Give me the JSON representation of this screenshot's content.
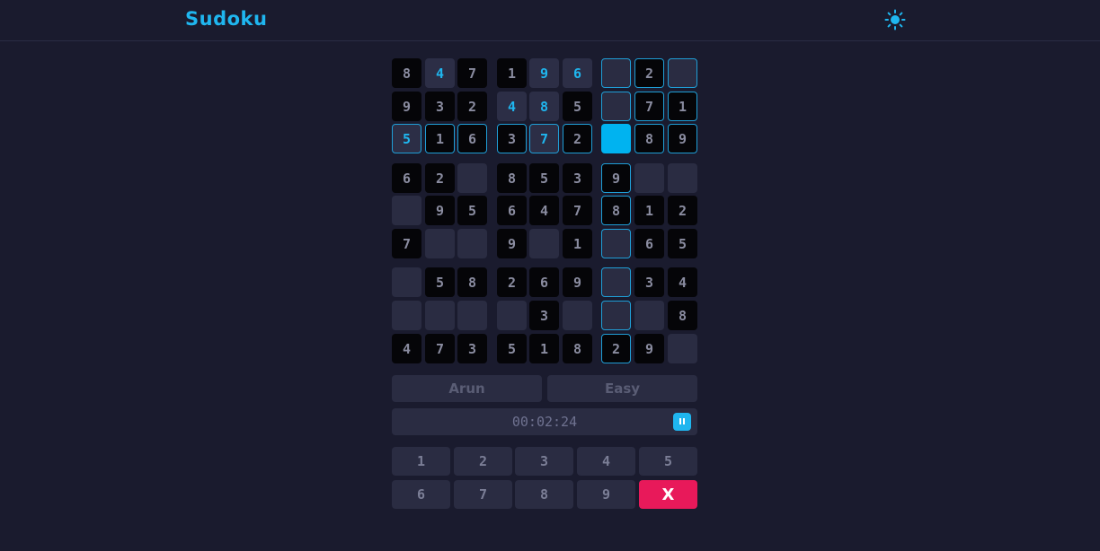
{
  "header": {
    "title": "Sudoku",
    "theme_icon": "sun-icon",
    "accent": "#1fb6ef"
  },
  "board": {
    "rows": [
      [
        [
          "8",
          "given"
        ],
        [
          "4",
          "related"
        ],
        [
          "7",
          "given"
        ],
        [
          "1",
          "given"
        ],
        [
          "9",
          "related"
        ],
        [
          "6",
          "related"
        ],
        [
          "",
          "empty-hl"
        ],
        [
          "2",
          "given-hl"
        ],
        [
          "",
          "empty-hl"
        ]
      ],
      [
        [
          "9",
          "given"
        ],
        [
          "3",
          "given"
        ],
        [
          "2",
          "given"
        ],
        [
          "4",
          "related"
        ],
        [
          "8",
          "related"
        ],
        [
          "5",
          "given"
        ],
        [
          "",
          "empty-hl"
        ],
        [
          "7",
          "given-hl"
        ],
        [
          "1",
          "given-hl"
        ]
      ],
      [
        [
          "5",
          "related-hl"
        ],
        [
          "1",
          "given-hl"
        ],
        [
          "6",
          "given-hl"
        ],
        [
          "3",
          "given-hl"
        ],
        [
          "7",
          "related-hl"
        ],
        [
          "2",
          "given-hl"
        ],
        [
          "",
          "selected"
        ],
        [
          "8",
          "given-hl"
        ],
        [
          "9",
          "given-hl"
        ]
      ],
      [
        [
          "6",
          "given"
        ],
        [
          "2",
          "given"
        ],
        [
          "",
          "empty"
        ],
        [
          "8",
          "given"
        ],
        [
          "5",
          "given"
        ],
        [
          "3",
          "given"
        ],
        [
          "9",
          "given-hl"
        ],
        [
          "",
          "empty"
        ],
        [
          "",
          "empty"
        ]
      ],
      [
        [
          "",
          "empty"
        ],
        [
          "9",
          "given"
        ],
        [
          "5",
          "given"
        ],
        [
          "6",
          "given"
        ],
        [
          "4",
          "given"
        ],
        [
          "7",
          "given"
        ],
        [
          "8",
          "given-hl"
        ],
        [
          "1",
          "given"
        ],
        [
          "2",
          "given"
        ]
      ],
      [
        [
          "7",
          "given"
        ],
        [
          "",
          "empty"
        ],
        [
          "",
          "empty"
        ],
        [
          "9",
          "given"
        ],
        [
          "",
          "empty"
        ],
        [
          "1",
          "given"
        ],
        [
          "",
          "empty-hl"
        ],
        [
          "6",
          "given"
        ],
        [
          "5",
          "given"
        ]
      ],
      [
        [
          "",
          "empty"
        ],
        [
          "5",
          "given"
        ],
        [
          "8",
          "given"
        ],
        [
          "2",
          "given"
        ],
        [
          "6",
          "given"
        ],
        [
          "9",
          "given"
        ],
        [
          "",
          "empty-hl"
        ],
        [
          "3",
          "given"
        ],
        [
          "4",
          "given"
        ]
      ],
      [
        [
          "",
          "empty"
        ],
        [
          "",
          "empty"
        ],
        [
          "",
          "empty"
        ],
        [
          "",
          "empty"
        ],
        [
          "3",
          "given"
        ],
        [
          "",
          "empty"
        ],
        [
          "",
          "empty-hl"
        ],
        [
          "",
          "empty"
        ],
        [
          "8",
          "given"
        ]
      ],
      [
        [
          "4",
          "given"
        ],
        [
          "7",
          "given"
        ],
        [
          "3",
          "given"
        ],
        [
          "5",
          "given"
        ],
        [
          "1",
          "given"
        ],
        [
          "8",
          "given"
        ],
        [
          "2",
          "given-hl"
        ],
        [
          "9",
          "given"
        ],
        [
          "",
          "empty"
        ]
      ]
    ]
  },
  "player": {
    "name": "Arun"
  },
  "difficulty": {
    "label": "Easy"
  },
  "timer": {
    "value": "00:02:24",
    "pause_icon": "pause-icon"
  },
  "numpad": {
    "keys": [
      "1",
      "2",
      "3",
      "4",
      "5",
      "6",
      "7",
      "8",
      "9"
    ],
    "erase_label": "X",
    "erase_color": "#e8195a"
  }
}
